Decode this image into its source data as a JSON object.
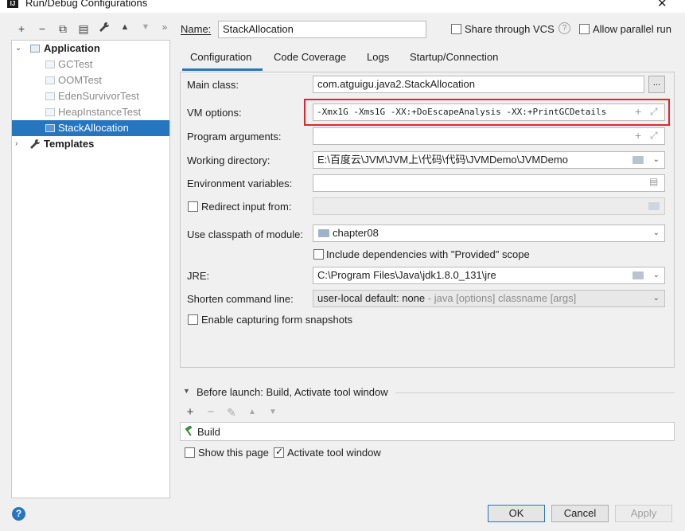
{
  "window": {
    "title": "Run/Debug Configurations",
    "app_icon": "ij-logo",
    "close": "✕"
  },
  "toolbar": {
    "add": "+",
    "remove": "−",
    "copy": "⧉",
    "save": "▤",
    "edit_templates": "wrench-icon",
    "move_up": "▲",
    "move_down": "▼",
    "more": "»"
  },
  "tree": {
    "application": "Application",
    "items": [
      "GCTest",
      "OOMTest",
      "EdenSurvivorTest",
      "HeapInstanceTest",
      "StackAllocation"
    ],
    "selected_index": 4,
    "templates": "Templates"
  },
  "name_row": {
    "label": "Name:",
    "value": "StackAllocation",
    "share_vcs": "Share through VCS",
    "share_checked": false,
    "allow_parallel": "Allow parallel run",
    "parallel_checked": false,
    "help": "?"
  },
  "tabs": [
    "Configuration",
    "Code Coverage",
    "Logs",
    "Startup/Connection"
  ],
  "active_tab": 0,
  "form": {
    "main_class_label": "Main class:",
    "main_class_value": "com.atguigu.java2.StackAllocation",
    "browse": "...",
    "vm_options_label": "VM options:",
    "vm_options_value": "-Xmx1G -Xms1G -XX:+DoEscapeAnalysis -XX:+PrintGCDetails",
    "program_args_label": "Program arguments:",
    "program_args_value": "",
    "working_dir_label": "Working directory:",
    "working_dir_value": "E:\\百度云\\JVM\\JVM上\\代码\\代码\\JVMDemo\\JVMDemo",
    "env_vars_label": "Environment variables:",
    "env_vars_value": "",
    "redirect_label": "Redirect input from:",
    "redirect_checked": false,
    "classpath_label": "Use classpath of module:",
    "classpath_value": "chapter08",
    "include_deps_label": "Include dependencies with \"Provided\" scope",
    "include_deps_checked": false,
    "jre_label": "JRE:",
    "jre_value": "C:\\Program Files\\Java\\jdk1.8.0_131\\jre",
    "shorten_label": "Shorten command line:",
    "shorten_value": "user-local default: none",
    "shorten_hint": "- java [options] classname [args]",
    "enable_snapshots_label": "Enable capturing form snapshots",
    "enable_snapshots_checked": false
  },
  "before_launch": {
    "title": "Before launch: Build, Activate tool window",
    "tools": {
      "add": "+",
      "remove": "−",
      "edit": "✎",
      "up": "▲",
      "down": "▼"
    },
    "items": [
      "Build"
    ],
    "show_page_label": "Show this page",
    "show_page_checked": false,
    "activate_label": "Activate tool window",
    "activate_checked": true
  },
  "buttons": {
    "ok": "OK",
    "cancel": "Cancel",
    "apply": "Apply"
  },
  "colors": {
    "accent": "#2675bf",
    "highlight_box": "#e0262c"
  }
}
